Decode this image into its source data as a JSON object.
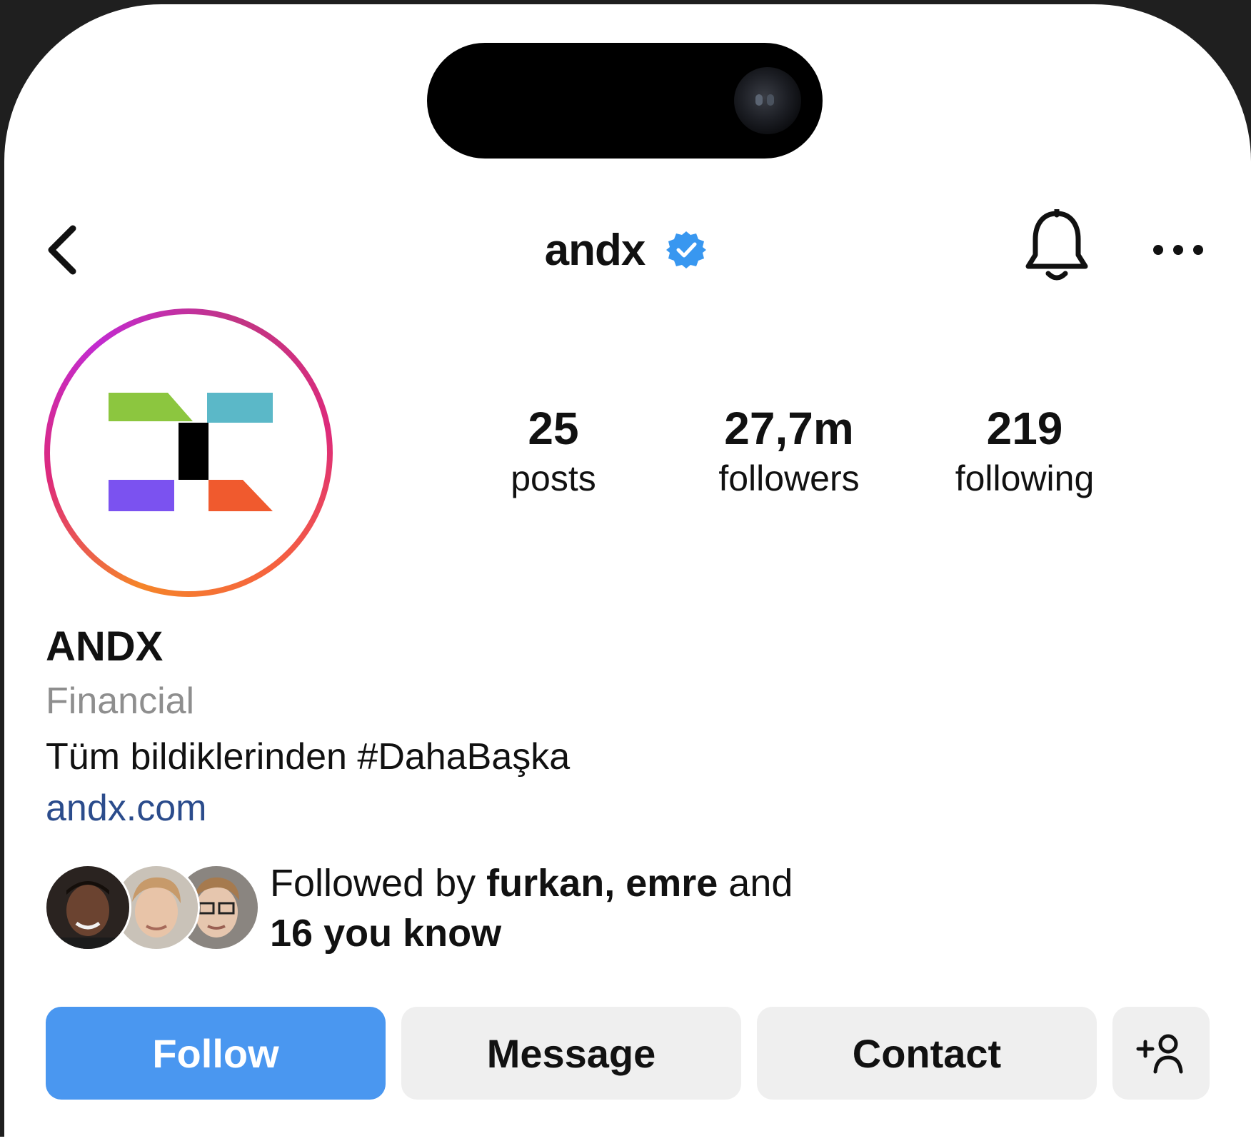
{
  "header": {
    "username": "andx",
    "verified": true,
    "verified_color": "#3897f0",
    "back_icon": "chevron-left-icon",
    "bell_icon": "bell-icon",
    "more_icon": "more-horizontal-icon"
  },
  "stats": [
    {
      "value": "25",
      "label": "posts"
    },
    {
      "value": "27,7m",
      "label": "followers"
    },
    {
      "value": "219",
      "label": "following"
    }
  ],
  "profile": {
    "display_name": "ANDX",
    "category": "Financial",
    "bio": "Tüm bildiklerinden #DahaBaşka",
    "link": "andx.com",
    "logo_colors": [
      "#8cc63f",
      "#5bb8c8",
      "#000000",
      "#7b52f0",
      "#f05a2e"
    ]
  },
  "followed_by": {
    "prefix": "Followed by ",
    "names": "furkan, emre",
    "middle": " and",
    "rest": "16 you know"
  },
  "actions": {
    "follow_label": "Follow",
    "message_label": "Message",
    "contact_label": "Contact",
    "add_icon": "add-person-icon",
    "follow_color": "#4a97f0"
  }
}
